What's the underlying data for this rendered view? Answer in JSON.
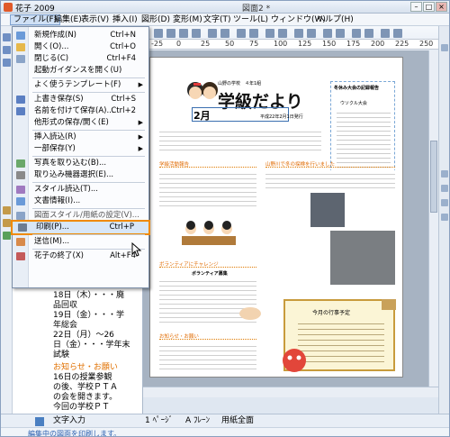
{
  "window": {
    "app_title": "花子 2009",
    "doc_title": "図面2 *"
  },
  "menubar": [
    {
      "label": "ファイル(F)",
      "active": true
    },
    {
      "label": "編集(E)"
    },
    {
      "label": "表示(V)"
    },
    {
      "label": "挿入(I)"
    },
    {
      "label": "図形(D)"
    },
    {
      "label": "変形(M)"
    },
    {
      "label": "文字(T)"
    },
    {
      "label": "ツール(L)"
    },
    {
      "label": "ウィンドウ(W)"
    },
    {
      "label": "ヘルプ(H)"
    }
  ],
  "file_menu": [
    {
      "label": "新規作成(N)",
      "shortcut": "Ctrl+N",
      "icon": "new-doc-icon"
    },
    {
      "label": "開く(O)...",
      "shortcut": "Ctrl+O",
      "icon": "open-folder-icon"
    },
    {
      "label": "閉じる(C)",
      "shortcut": "Ctrl+F4",
      "icon": "close-doc-icon"
    },
    {
      "label": "起動ガイダンスを開く(U)",
      "icon": ""
    },
    {
      "sep": true
    },
    {
      "label": "よく使うテンプレート(F)",
      "submenu": true,
      "icon": ""
    },
    {
      "sep": true
    },
    {
      "label": "上書き保存(S)",
      "shortcut": "Ctrl+S",
      "icon": "save-icon"
    },
    {
      "label": "名前を付けて保存(A)...",
      "shortcut": "Ctrl+2",
      "icon": "save-as-icon"
    },
    {
      "label": "他形式の保存/開く(E)",
      "submenu": true,
      "icon": ""
    },
    {
      "sep": true
    },
    {
      "label": "挿入読込(R)",
      "submenu": true,
      "icon": ""
    },
    {
      "label": "一部保存(Y)",
      "submenu": true,
      "icon": ""
    },
    {
      "sep": true
    },
    {
      "label": "写真を取り込む(B)...",
      "icon": "photo-import-icon"
    },
    {
      "label": "取り込み機器選択(E)...",
      "icon": "device-select-icon"
    },
    {
      "sep": true
    },
    {
      "label": "スタイル読込(T)...",
      "icon": "style-load-icon"
    },
    {
      "label": "文書情報(I)...",
      "icon": "doc-info-icon"
    },
    {
      "sep": true
    },
    {
      "label": "図面スタイル/用紙の設定(V)...",
      "icon": "page-setup-icon",
      "disabled": true
    },
    {
      "label": "印刷(P)...",
      "shortcut": "Ctrl+P",
      "icon": "print-icon",
      "highlighted": true
    },
    {
      "sep": true
    },
    {
      "label": "送信(M)...",
      "icon": "send-icon"
    },
    {
      "sep": true
    },
    {
      "label": "花子の終了(X)",
      "shortcut": "Alt+F4",
      "icon": "exit-icon"
    }
  ],
  "ruler_marks": [
    "-25",
    "0",
    "25",
    "50",
    "75",
    "100",
    "125",
    "150",
    "175",
    "200",
    "225",
    "250"
  ],
  "left_panel_text": {
    "lines": [
      "18日（木）・・・廃",
      "品回収",
      "19日（金）・・・学",
      "年総会",
      "22日（月）～26",
      "日（金）・・・学年末",
      "試験"
    ],
    "notice_heading": "お知らせ・お願い",
    "notice_lines": [
      "16日の授業参観",
      "の後、学校ＰＴＡ",
      "の会を開きます。",
      "今回の学校ＰＴ"
    ]
  },
  "page": {
    "school_line": "山野の学校　４年1組",
    "title": "学級だより",
    "month": "2月",
    "issue_date": "平成22年2月1日発行",
    "sections": [
      "学級活動報告",
      "山野川で冬の探検を行いました",
      "ボランティアにチャレンジ",
      "お知らせ・お願い"
    ],
    "events_title": "今月の行事予定",
    "volunteer_heading": "ボランティア募集",
    "right_box_title": "冬休み大会の記録報告",
    "right_box_sub": "ウソクル大会"
  },
  "tabbar": {
    "outline_label": "文字入力",
    "page_indicator": "1 ﾍﾟｰｼﾞ",
    "layer_label": "A ﾌﾚｰﾝ",
    "view_mode": "用紙全面"
  },
  "statusbar": {
    "message": "編集中の図面を印刷します。"
  },
  "colors": {
    "accent": "#f08a00",
    "highlight": "#d8e6f7",
    "status_text": "#2b5fb0"
  }
}
